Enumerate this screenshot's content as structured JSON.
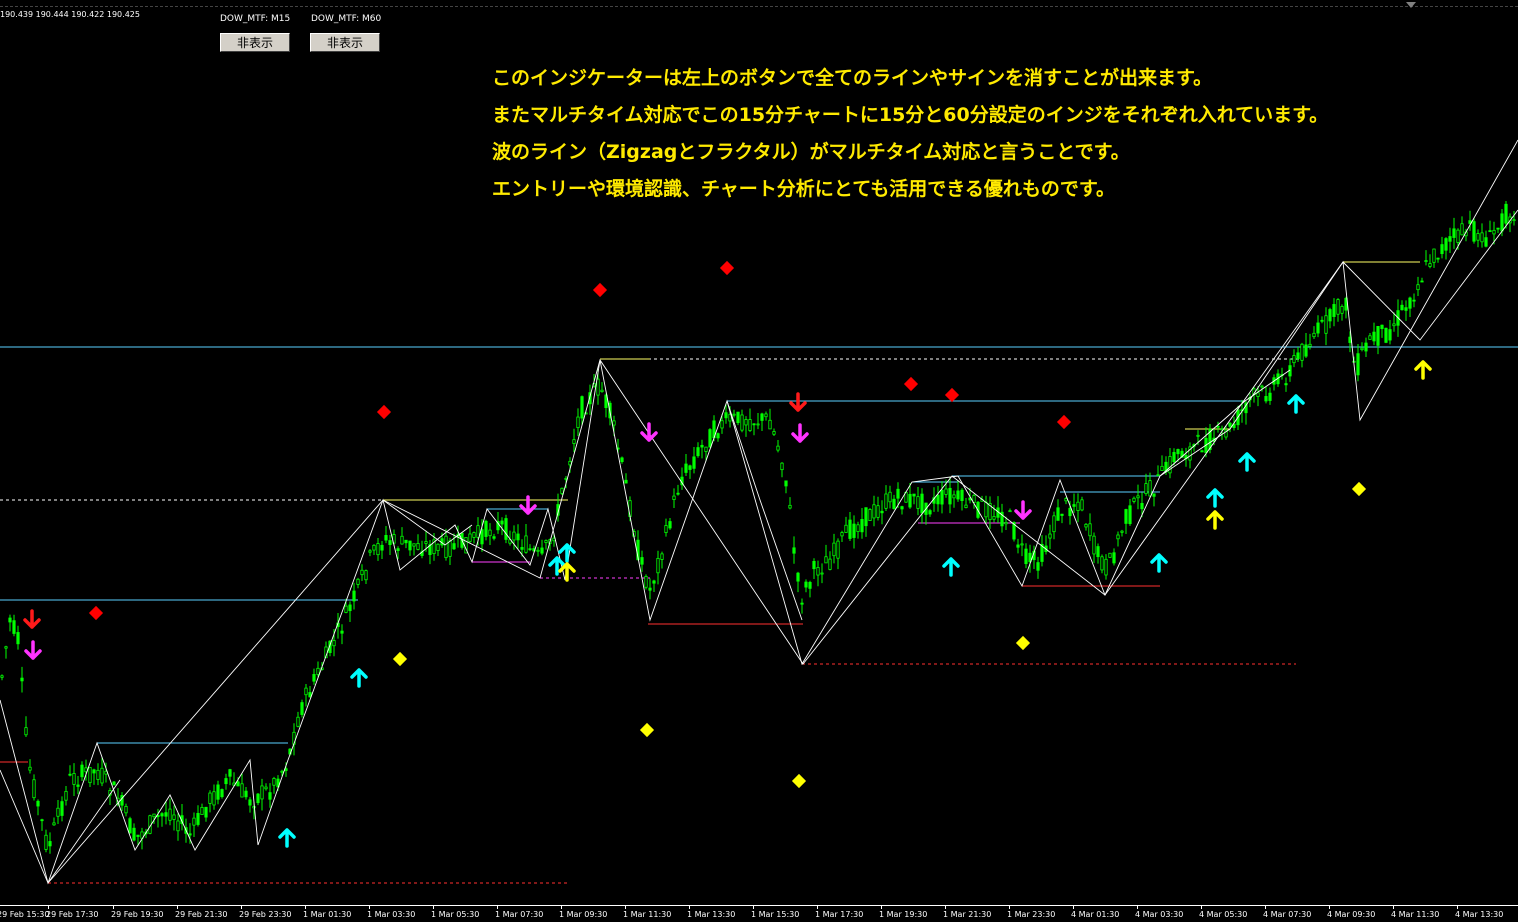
{
  "ohlc_text": "190.439 190.444 190.422 190.425",
  "indicators": [
    {
      "label": "DOW_MTF:  M15"
    },
    {
      "label": "DOW_MTF:  M60"
    }
  ],
  "buttons": [
    {
      "label": "非表示"
    },
    {
      "label": "非表示"
    }
  ],
  "note_lines": [
    "このインジケーターは左上のボタンで全てのラインやサインを消すことが出来ます。",
    "またマルチタイム対応でこの15分チャートに15分と60分設定のインジをそれぞれ入れています。",
    "波のライン（Zigzagとフラクタル）がマルチタイム対応と言うことです。",
    "エントリーや環境認識、チャート分析にとても活用できる優れものです。"
  ],
  "colors": {
    "background": "#000000",
    "candle": "#00ff00",
    "zigzag": "#ffffff",
    "level_cyan": "#5ad0ff",
    "level_red": "#ff3030",
    "level_yellow": "#ffff66",
    "level_magenta": "#ff40ff",
    "note_text": "#ffea00",
    "arrow_cyan": "#00ffff",
    "arrow_magenta": "#ff33ff",
    "arrow_red": "#ff1a1a",
    "arrow_yellow": "#ffff00",
    "diamond_red": "#ff0000",
    "diamond_yellow": "#ffff00"
  },
  "time_axis": [
    "29 Feb 15:30",
    "29 Feb 17:30",
    "29 Feb 19:30",
    "29 Feb 21:30",
    "29 Feb 23:30",
    "1 Mar 01:30",
    "1 Mar 03:30",
    "1 Mar 05:30",
    "1 Mar 07:30",
    "1 Mar 09:30",
    "1 Mar 11:30",
    "1 Mar 13:30",
    "1 Mar 15:30",
    "1 Mar 17:30",
    "1 Mar 19:30",
    "1 Mar 21:30",
    "1 Mar 23:30",
    "4 Mar 01:30",
    "4 Mar 03:30",
    "4 Mar 05:30",
    "4 Mar 07:30",
    "4 Mar 09:30",
    "4 Mar 11:30",
    "4 Mar 13:30"
  ],
  "chart_data": {
    "type": "line",
    "symbol_timeframe": "M15",
    "zigzag_pivots": [
      {
        "time": "29 Feb 15:00",
        "level": "low"
      },
      {
        "time": "29 Feb 17:30",
        "level": "high"
      },
      {
        "time": "29 Feb 23:00",
        "level": "low"
      },
      {
        "time": "1 Mar 03:00",
        "level": "high"
      },
      {
        "time": "1 Mar 07:30",
        "level": "low"
      },
      {
        "time": "1 Mar 09:30",
        "level": "high"
      },
      {
        "time": "1 Mar 11:30",
        "level": "low"
      },
      {
        "time": "1 Mar 13:30",
        "level": "high"
      },
      {
        "time": "1 Mar 15:30",
        "level": "low"
      },
      {
        "time": "1 Mar 19:30",
        "level": "high"
      },
      {
        "time": "1 Mar 23:00",
        "level": "low"
      },
      {
        "time": "4 Mar 01:00",
        "level": "high"
      },
      {
        "time": "4 Mar 02:30",
        "level": "low"
      },
      {
        "time": "4 Mar 09:30",
        "level": "high"
      },
      {
        "time": "4 Mar 10:00",
        "level": "low"
      },
      {
        "time": "4 Mar 13:30",
        "level": "high"
      }
    ],
    "signals": {
      "buy_arrows_cyan": 11,
      "sell_arrows_magenta": 5,
      "sell_arrows_red": 2,
      "buy_arrows_yellow": 3,
      "red_diamonds": 8,
      "yellow_diamonds": 6
    }
  }
}
